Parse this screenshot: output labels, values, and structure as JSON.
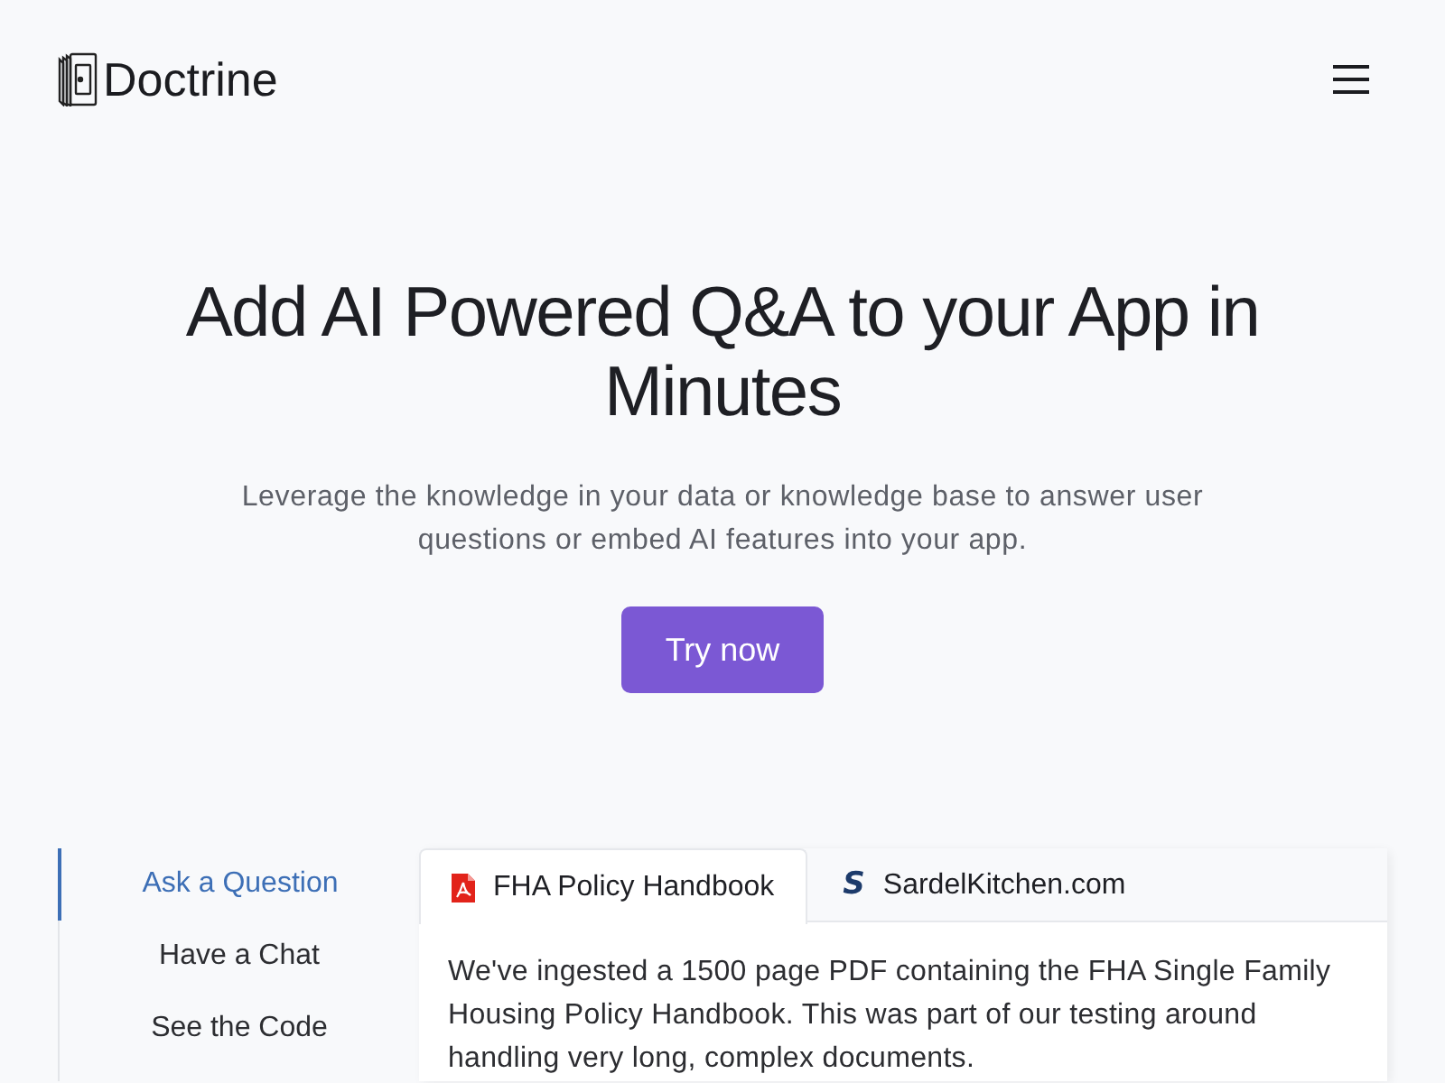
{
  "header": {
    "brand": "Doctrine"
  },
  "hero": {
    "title": "Add AI Powered Q&A to your App in Minutes",
    "subtitle": "Leverage the knowledge in your data or knowledge base to answer user questions or embed AI features into your app.",
    "cta": "Try now"
  },
  "demo": {
    "nav": [
      {
        "label": "Ask a Question",
        "selected": true
      },
      {
        "label": "Have a Chat",
        "selected": false
      },
      {
        "label": "See the Code",
        "selected": false
      }
    ],
    "tabs": [
      {
        "kind": "pdf",
        "label": "FHA Policy Handbook",
        "selected": true
      },
      {
        "kind": "site",
        "logo_letter": "S",
        "label": "SardelKitchen.com",
        "selected": false
      }
    ],
    "description": "We've ingested a 1500 page PDF containing the FHA Single Family Housing Policy Handbook. This was part of our testing around handling very long, complex documents."
  }
}
